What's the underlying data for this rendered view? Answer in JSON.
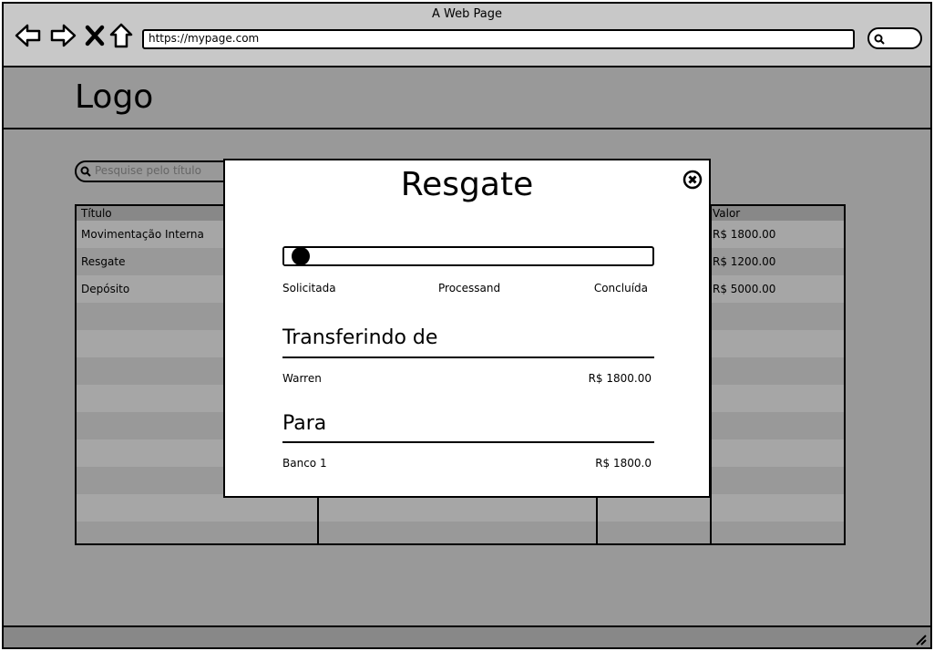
{
  "window": {
    "title": "A Web Page",
    "url": "https://mypage.com"
  },
  "header": {
    "logo": "Logo"
  },
  "search": {
    "placeholder": "Pesquise pelo título"
  },
  "table": {
    "columns": [
      "Título",
      "Valor"
    ],
    "rows": [
      {
        "title": "Movimentação Interna",
        "value": "R$ 1800.00"
      },
      {
        "title": "Resgate",
        "value": "R$ 1200.00"
      },
      {
        "title": "Depósito",
        "value": "R$ 5000.00"
      }
    ]
  },
  "modal": {
    "title": "Resgate",
    "progress": {
      "value_percent": 2
    },
    "steps": [
      "Solicitada",
      "Processand",
      "Concluída"
    ],
    "from": {
      "heading": "Transferindo de",
      "name": "Warren",
      "amount": "R$ 1800.00"
    },
    "to": {
      "heading": "Para",
      "name": "Banco 1",
      "amount": "R$ 1800.0"
    }
  },
  "icons": [
    "back-icon",
    "forward-icon",
    "close-icon",
    "home-icon",
    "search-icon",
    "modal-close-icon",
    "resize-grip-icon"
  ]
}
